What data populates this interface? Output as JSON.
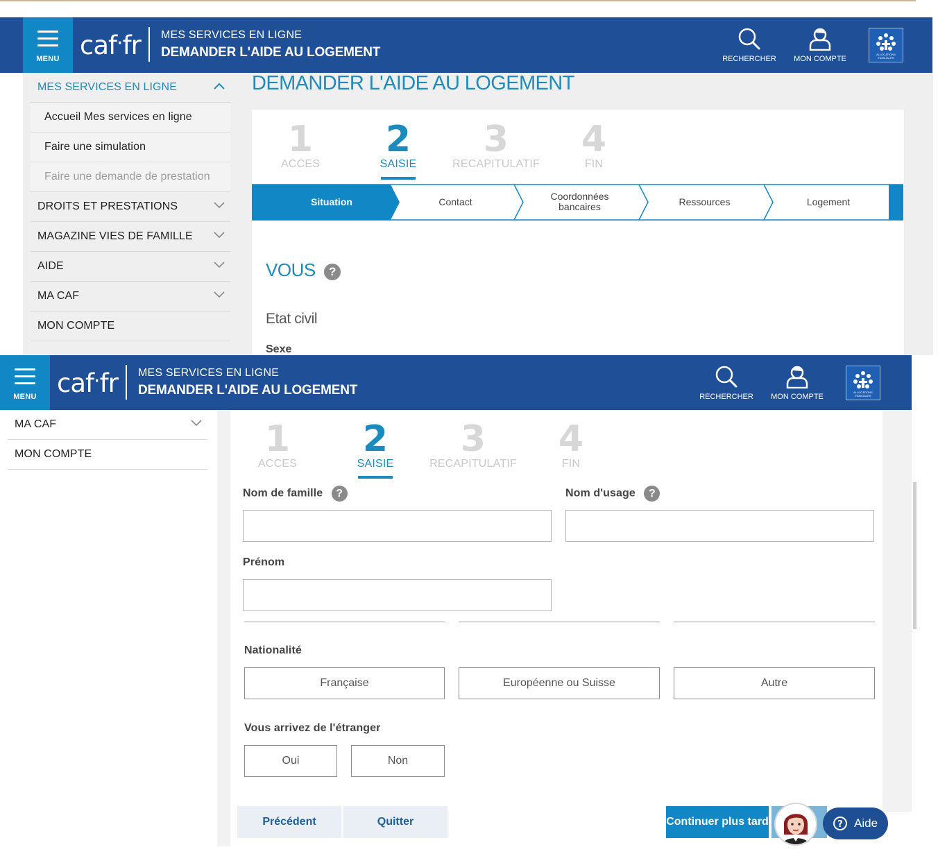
{
  "header": {
    "menu_label": "MENU",
    "logo_left": "caf",
    "logo_right": "fr",
    "title_line1": "MES SERVICES EN LIGNE",
    "title_line2": "DEMANDER L'AIDE AU LOGEMENT",
    "search_label": "RECHERCHER",
    "account_label": "MON COMPTE",
    "emblem_text_1": "ALLOCATIONS",
    "emblem_text_2": "FAMILIALES"
  },
  "sidebar": {
    "section_label": "MES SERVICES EN LIGNE",
    "sub_items": [
      "Accueil Mes services en ligne",
      "Faire une simulation",
      "Faire une demande de prestation"
    ],
    "items": [
      "DROITS ET PRESTATIONS",
      "MAGAZINE VIES DE FAMILLE",
      "AIDE",
      "MA CAF",
      "MON COMPTE"
    ]
  },
  "page_title": "DEMANDER L'AIDE AU LOGEMENT",
  "steps": [
    {
      "num": "1",
      "label": "ACCES"
    },
    {
      "num": "2",
      "label": "SAISIE"
    },
    {
      "num": "3",
      "label": "RECAPITULATIF"
    },
    {
      "num": "4",
      "label": "FIN"
    }
  ],
  "substeps": [
    "Situation",
    "Contact",
    "Coordonnées bancaires",
    "Ressources",
    "Logement"
  ],
  "section": {
    "title": "VOUS",
    "subtitle": "Etat civil",
    "sexe_label": "Sexe",
    "help_glyph": "?"
  },
  "form": {
    "nom_famille_label": "Nom de famille",
    "nom_usage_label": "Nom d'usage",
    "prenom_label": "Prénom",
    "nationalite_label": "Nationalité",
    "nationalite_options": [
      "Française",
      "Européenne ou Suisse",
      "Autre"
    ],
    "etranger_label": "Vous arrivez de l'étranger",
    "etranger_options": [
      "Oui",
      "Non"
    ]
  },
  "actions": {
    "previous": "Précédent",
    "quit": "Quitter",
    "continue_later": "Continuer plus tard",
    "help": "Aide"
  },
  "colors": {
    "header_blue": "#1f4f97",
    "accent_blue": "#1287c5",
    "link_blue": "#1b8bbd"
  }
}
